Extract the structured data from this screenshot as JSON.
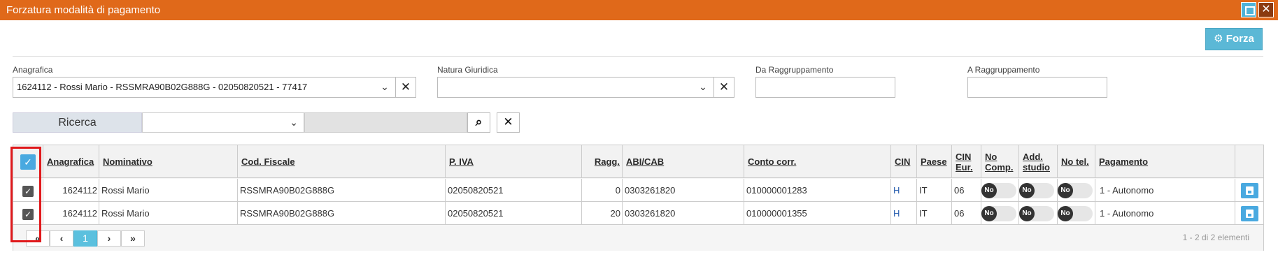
{
  "window": {
    "title": "Forzatura modalità di pagamento",
    "close_label": "✕"
  },
  "toolbar": {
    "forza_label": "Forza"
  },
  "filters": {
    "anagrafica_label": "Anagrafica",
    "anagrafica_value": "1624112 - Rossi Mario - RSSMRA90B02G888G - 02050820521 - 77417",
    "natura_label": "Natura Giuridica",
    "natura_value": "",
    "da_label": "Da Raggruppamento",
    "a_label": "A Raggruppamento"
  },
  "search": {
    "label": "Ricerca"
  },
  "table": {
    "headers": {
      "anagrafica": "Anagrafica",
      "nominativo": "Nominativo",
      "cod_fiscale": "Cod. Fiscale",
      "piva": "P. IVA",
      "ragg": "Ragg.",
      "abicab": "ABI/CAB",
      "conto": "Conto corr.",
      "cin": "CIN",
      "paese": "Paese",
      "cin_eur": "CIN Eur.",
      "no_comp": "No Comp.",
      "add_studio": "Add. studio",
      "no_tel": "No tel.",
      "pagamento": "Pagamento"
    },
    "rows": [
      {
        "anagrafica": "1624112",
        "nominativo": "Rossi Mario",
        "cod_fiscale": "RSSMRA90B02G888G",
        "piva": "02050820521",
        "ragg": "0",
        "abicab": "0303261820",
        "conto": "010000001283",
        "cin": "H",
        "paese": "IT",
        "cin_eur": "06",
        "no_comp": "No",
        "add_studio": "No",
        "no_tel": "No",
        "pagamento": "1 - Autonomo"
      },
      {
        "anagrafica": "1624112",
        "nominativo": "Rossi Mario",
        "cod_fiscale": "RSSMRA90B02G888G",
        "piva": "02050820521",
        "ragg": "20",
        "abicab": "0303261820",
        "conto": "010000001355",
        "cin": "H",
        "paese": "IT",
        "cin_eur": "06",
        "no_comp": "No",
        "add_studio": "No",
        "no_tel": "No",
        "pagamento": "1 - Autonomo"
      }
    ]
  },
  "pager": {
    "first": "«",
    "prev": "‹",
    "current": "1",
    "next": "›",
    "last": "»",
    "info": "1 - 2 di 2 elementi"
  },
  "colors": {
    "titlebar": "#e0691a",
    "accent": "#5bb8d6",
    "highlight": "#e0181b"
  }
}
